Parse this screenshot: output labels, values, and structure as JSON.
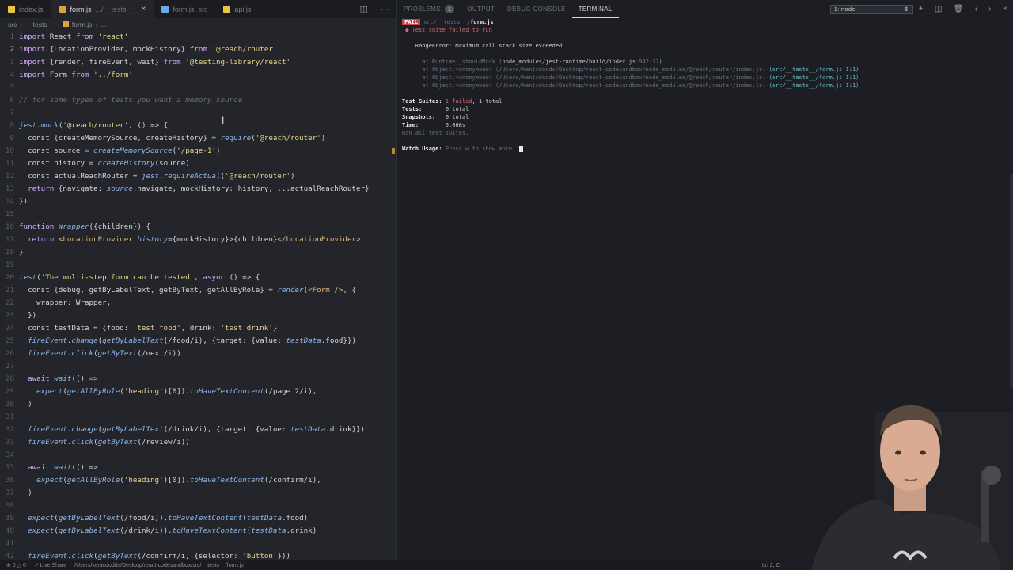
{
  "editor": {
    "tabs": [
      {
        "name": "index.js",
        "dim": "",
        "color": "#e8c547",
        "active": false
      },
      {
        "name": "form.js",
        "dim": ".../__tests__",
        "color": "#d9a341",
        "active": true,
        "close": "×"
      },
      {
        "name": "form.js",
        "dim": "src",
        "color": "#6fa8dc",
        "active": false
      },
      {
        "name": "api.js",
        "dim": "",
        "color": "#e8c547",
        "active": false
      }
    ],
    "breadcrumb": [
      "src",
      "__tests__",
      "form.js",
      "..."
    ],
    "lines": [
      {
        "n": "1",
        "t": [
          [
            "kw",
            "import"
          ],
          [
            "pl",
            " React "
          ],
          [
            "kw",
            "from"
          ],
          [
            "pl",
            " "
          ],
          [
            "str",
            "'react'"
          ]
        ]
      },
      {
        "n": "2",
        "cur": true,
        "t": [
          [
            "kw",
            "import"
          ],
          [
            "pl",
            " {LocationProvider, mockHistory} "
          ],
          [
            "kw",
            "from"
          ],
          [
            "pl",
            " "
          ],
          [
            "str",
            "'@reach/router'"
          ]
        ]
      },
      {
        "n": "3",
        "t": [
          [
            "kw",
            "import"
          ],
          [
            "pl",
            " {render, fireEvent, wait} "
          ],
          [
            "kw",
            "from"
          ],
          [
            "pl",
            " "
          ],
          [
            "str",
            "'@testing-library/react'"
          ]
        ]
      },
      {
        "n": "4",
        "t": [
          [
            "kw",
            "import"
          ],
          [
            "pl",
            " Form "
          ],
          [
            "kw",
            "from"
          ],
          [
            "pl",
            " "
          ],
          [
            "str",
            "'../form'"
          ]
        ]
      },
      {
        "n": "5",
        "t": []
      },
      {
        "n": "6",
        "t": [
          [
            "cm",
            "// for some types of tests you want a memory source"
          ]
        ]
      },
      {
        "n": "7",
        "t": []
      },
      {
        "n": "8",
        "t": [
          [
            "fn",
            "jest"
          ],
          [
            "pl",
            "."
          ],
          [
            "fn",
            "mock"
          ],
          [
            "pl",
            "("
          ],
          [
            "str",
            "'@reach/router'"
          ],
          [
            "pl",
            ", () => {"
          ]
        ]
      },
      {
        "n": "9",
        "t": [
          [
            "pl",
            "  const {createMemorySource, createHistory} = "
          ],
          [
            "fn",
            "require"
          ],
          [
            "pl",
            "("
          ],
          [
            "str",
            "'@reach/router'"
          ],
          [
            "pl",
            ")"
          ]
        ]
      },
      {
        "n": "10",
        "t": [
          [
            "pl",
            "  const source = "
          ],
          [
            "fn",
            "createMemorySource"
          ],
          [
            "pl",
            "("
          ],
          [
            "str",
            "'/page-1'"
          ],
          [
            "pl",
            ")"
          ]
        ]
      },
      {
        "n": "11",
        "t": [
          [
            "pl",
            "  const history = "
          ],
          [
            "fn",
            "createHistory"
          ],
          [
            "pl",
            "(source)"
          ]
        ]
      },
      {
        "n": "12",
        "t": [
          [
            "pl",
            "  const actualReachRouter = "
          ],
          [
            "fn",
            "jest"
          ],
          [
            "pl",
            "."
          ],
          [
            "fn",
            "requireActual"
          ],
          [
            "pl",
            "("
          ],
          [
            "str",
            "'@reach/router'"
          ],
          [
            "pl",
            ")"
          ]
        ]
      },
      {
        "n": "13",
        "t": [
          [
            "kw",
            "  return"
          ],
          [
            "pl",
            " {navigate: "
          ],
          [
            "fn",
            "source"
          ],
          [
            "pl",
            ".navigate, mockHistory: history, ...actualReachRouter}"
          ]
        ]
      },
      {
        "n": "14",
        "t": [
          [
            "pl",
            "})"
          ]
        ]
      },
      {
        "n": "15",
        "t": []
      },
      {
        "n": "16",
        "t": [
          [
            "kw",
            "function"
          ],
          [
            "pl",
            " "
          ],
          [
            "fn",
            "Wrapper"
          ],
          [
            "pl",
            "({children}) {"
          ]
        ]
      },
      {
        "n": "17",
        "t": [
          [
            "kw",
            "  return"
          ],
          [
            "pl",
            " "
          ],
          [
            "tg",
            "<LocationProvider"
          ],
          [
            "pl",
            " "
          ],
          [
            "fn",
            "history"
          ],
          [
            "pl",
            "={mockHistory}>{children}"
          ],
          [
            "tg",
            "</LocationProvider>"
          ]
        ]
      },
      {
        "n": "18",
        "t": [
          [
            "pl",
            "}"
          ]
        ]
      },
      {
        "n": "19",
        "t": []
      },
      {
        "n": "20",
        "t": [
          [
            "fn",
            "test"
          ],
          [
            "pl",
            "("
          ],
          [
            "str",
            "'The multi-step form can be tested'"
          ],
          [
            "pl",
            ", "
          ],
          [
            "kw",
            "async"
          ],
          [
            "pl",
            " () => {"
          ]
        ]
      },
      {
        "n": "21",
        "t": [
          [
            "pl",
            "  const {debug, getByLabelText, getByText, getAllByRole} = "
          ],
          [
            "fn",
            "render"
          ],
          [
            "pl",
            "("
          ],
          [
            "tg",
            "<Form />"
          ],
          [
            "pl",
            ", {"
          ]
        ]
      },
      {
        "n": "22",
        "t": [
          [
            "pl",
            "    wrapper: Wrapper,"
          ]
        ]
      },
      {
        "n": "23",
        "t": [
          [
            "pl",
            "  })"
          ]
        ]
      },
      {
        "n": "24",
        "t": [
          [
            "pl",
            "  const testData = {food: "
          ],
          [
            "str",
            "'test food'"
          ],
          [
            "pl",
            ", drink: "
          ],
          [
            "str",
            "'test drink'"
          ],
          [
            "pl",
            "}"
          ]
        ]
      },
      {
        "n": "25",
        "t": [
          [
            "fn",
            "  fireEvent"
          ],
          [
            "pl",
            "."
          ],
          [
            "fn",
            "change"
          ],
          [
            "pl",
            "("
          ],
          [
            "fn",
            "getByLabelText"
          ],
          [
            "pl",
            "(/food/i), {target: {value: "
          ],
          [
            "fn",
            "testData"
          ],
          [
            "pl",
            ".food}})"
          ]
        ]
      },
      {
        "n": "26",
        "t": [
          [
            "fn",
            "  fireEvent"
          ],
          [
            "pl",
            "."
          ],
          [
            "fn",
            "click"
          ],
          [
            "pl",
            "("
          ],
          [
            "fn",
            "getByText"
          ],
          [
            "pl",
            "(/next/i))"
          ]
        ]
      },
      {
        "n": "27",
        "t": []
      },
      {
        "n": "28",
        "t": [
          [
            "kw",
            "  await"
          ],
          [
            "pl",
            " "
          ],
          [
            "fn",
            "wait"
          ],
          [
            "pl",
            "(() =>"
          ]
        ]
      },
      {
        "n": "29",
        "t": [
          [
            "pl",
            "    "
          ],
          [
            "fn",
            "expect"
          ],
          [
            "pl",
            "("
          ],
          [
            "fn",
            "getAllByRole"
          ],
          [
            "pl",
            "("
          ],
          [
            "str",
            "'heading'"
          ],
          [
            "pl",
            ")[0])."
          ],
          [
            "fn",
            "toHaveTextContent"
          ],
          [
            "pl",
            "(/page 2/i),"
          ]
        ]
      },
      {
        "n": "30",
        "t": [
          [
            "pl",
            "  )"
          ]
        ]
      },
      {
        "n": "31",
        "t": []
      },
      {
        "n": "32",
        "t": [
          [
            "fn",
            "  fireEvent"
          ],
          [
            "pl",
            "."
          ],
          [
            "fn",
            "change"
          ],
          [
            "pl",
            "("
          ],
          [
            "fn",
            "getByLabelText"
          ],
          [
            "pl",
            "(/drink/i), {target: {value: "
          ],
          [
            "fn",
            "testData"
          ],
          [
            "pl",
            ".drink}})"
          ]
        ]
      },
      {
        "n": "33",
        "t": [
          [
            "fn",
            "  fireEvent"
          ],
          [
            "pl",
            "."
          ],
          [
            "fn",
            "click"
          ],
          [
            "pl",
            "("
          ],
          [
            "fn",
            "getByText"
          ],
          [
            "pl",
            "(/review/i))"
          ]
        ]
      },
      {
        "n": "34",
        "t": []
      },
      {
        "n": "35",
        "t": [
          [
            "kw",
            "  await"
          ],
          [
            "pl",
            " "
          ],
          [
            "fn",
            "wait"
          ],
          [
            "pl",
            "(() =>"
          ]
        ]
      },
      {
        "n": "36",
        "t": [
          [
            "pl",
            "    "
          ],
          [
            "fn",
            "expect"
          ],
          [
            "pl",
            "("
          ],
          [
            "fn",
            "getAllByRole"
          ],
          [
            "pl",
            "("
          ],
          [
            "str",
            "'heading'"
          ],
          [
            "pl",
            ")[0])."
          ],
          [
            "fn",
            "toHaveTextContent"
          ],
          [
            "pl",
            "(/confirm/i),"
          ]
        ]
      },
      {
        "n": "37",
        "t": [
          [
            "pl",
            "  )"
          ]
        ]
      },
      {
        "n": "38",
        "t": []
      },
      {
        "n": "39",
        "t": [
          [
            "pl",
            "  "
          ],
          [
            "fn",
            "expect"
          ],
          [
            "pl",
            "("
          ],
          [
            "fn",
            "getByLabelText"
          ],
          [
            "pl",
            "(/food/i))."
          ],
          [
            "fn",
            "toHaveTextContent"
          ],
          [
            "pl",
            "("
          ],
          [
            "fn",
            "testData"
          ],
          [
            "pl",
            ".food)"
          ]
        ]
      },
      {
        "n": "40",
        "t": [
          [
            "pl",
            "  "
          ],
          [
            "fn",
            "expect"
          ],
          [
            "pl",
            "("
          ],
          [
            "fn",
            "getByLabelText"
          ],
          [
            "pl",
            "(/drink/i))."
          ],
          [
            "fn",
            "toHaveTextContent"
          ],
          [
            "pl",
            "("
          ],
          [
            "fn",
            "testData"
          ],
          [
            "pl",
            ".drink)"
          ]
        ]
      },
      {
        "n": "41",
        "t": []
      },
      {
        "n": "42",
        "t": [
          [
            "fn",
            "  fireEvent"
          ],
          [
            "pl",
            "."
          ],
          [
            "fn",
            "click"
          ],
          [
            "pl",
            "("
          ],
          [
            "fn",
            "getByText"
          ],
          [
            "pl",
            "(/confirm/i, {selector: "
          ],
          [
            "str",
            "'button'"
          ],
          [
            "pl",
            "}))"
          ]
        ]
      }
    ]
  },
  "panel": {
    "tabs": [
      "PROBLEMS",
      "OUTPUT",
      "DEBUG CONSOLE",
      "TERMINAL"
    ],
    "problems_count": "1",
    "terminal_select": "1: node",
    "terminal": {
      "fail_tag": "FAIL",
      "fail_path_dim": "src/__tests__/",
      "fail_path_file": "form.js",
      "suite_failed": "● Test suite failed to run",
      "error": "RangeError: Maximum call stack size exceeded",
      "stack": [
        {
          "pre": "at Runtime._shouldMock (",
          "path": "node_modules/jest-runtime/build/index.js",
          "loc": ":942:37",
          "post": ")"
        },
        {
          "pre": "at Object.<anonymous> (",
          "path": "/Users/kentcdodds/Desktop/react-codesandbox/node_modules/@reach/router/index.js",
          "loc": "",
          "post": ": (src/__tests__/form.js:1:1)"
        },
        {
          "pre": "at Object.<anonymous> (",
          "path": "/Users/kentcdodds/Desktop/react-codesandbox/node_modules/@reach/router/index.js",
          "loc": "",
          "post": ": (src/__tests__/form.js:1:1)"
        },
        {
          "pre": "at Object.<anonymous> (",
          "path": "/Users/kentcdodds/Desktop/react-codesandbox/node_modules/@reach/router/index.js",
          "loc": "",
          "post": ": (src/__tests__/form.js:1:1)"
        }
      ],
      "summary": {
        "suites_label": "Test Suites:",
        "suites_failed": "1 failed",
        "suites_total": ", 1 total",
        "tests_label": "Tests:",
        "tests_val": "0 total",
        "snap_label": "Snapshots:",
        "snap_val": "0 total",
        "time_label": "Time:",
        "time_val": "0.068s",
        "ran": "Ran all test suites."
      },
      "watch_label": "Watch Usage:",
      "watch_hint": "Press w to show more."
    }
  },
  "status": {
    "errors": "⊗ 0 △ 0",
    "live_share": "Live Share",
    "path": "/Users/kentcdodds/Desktop/react-codesandbox/src/__tests__/form.js",
    "position": "Ln 2, Col 9"
  }
}
